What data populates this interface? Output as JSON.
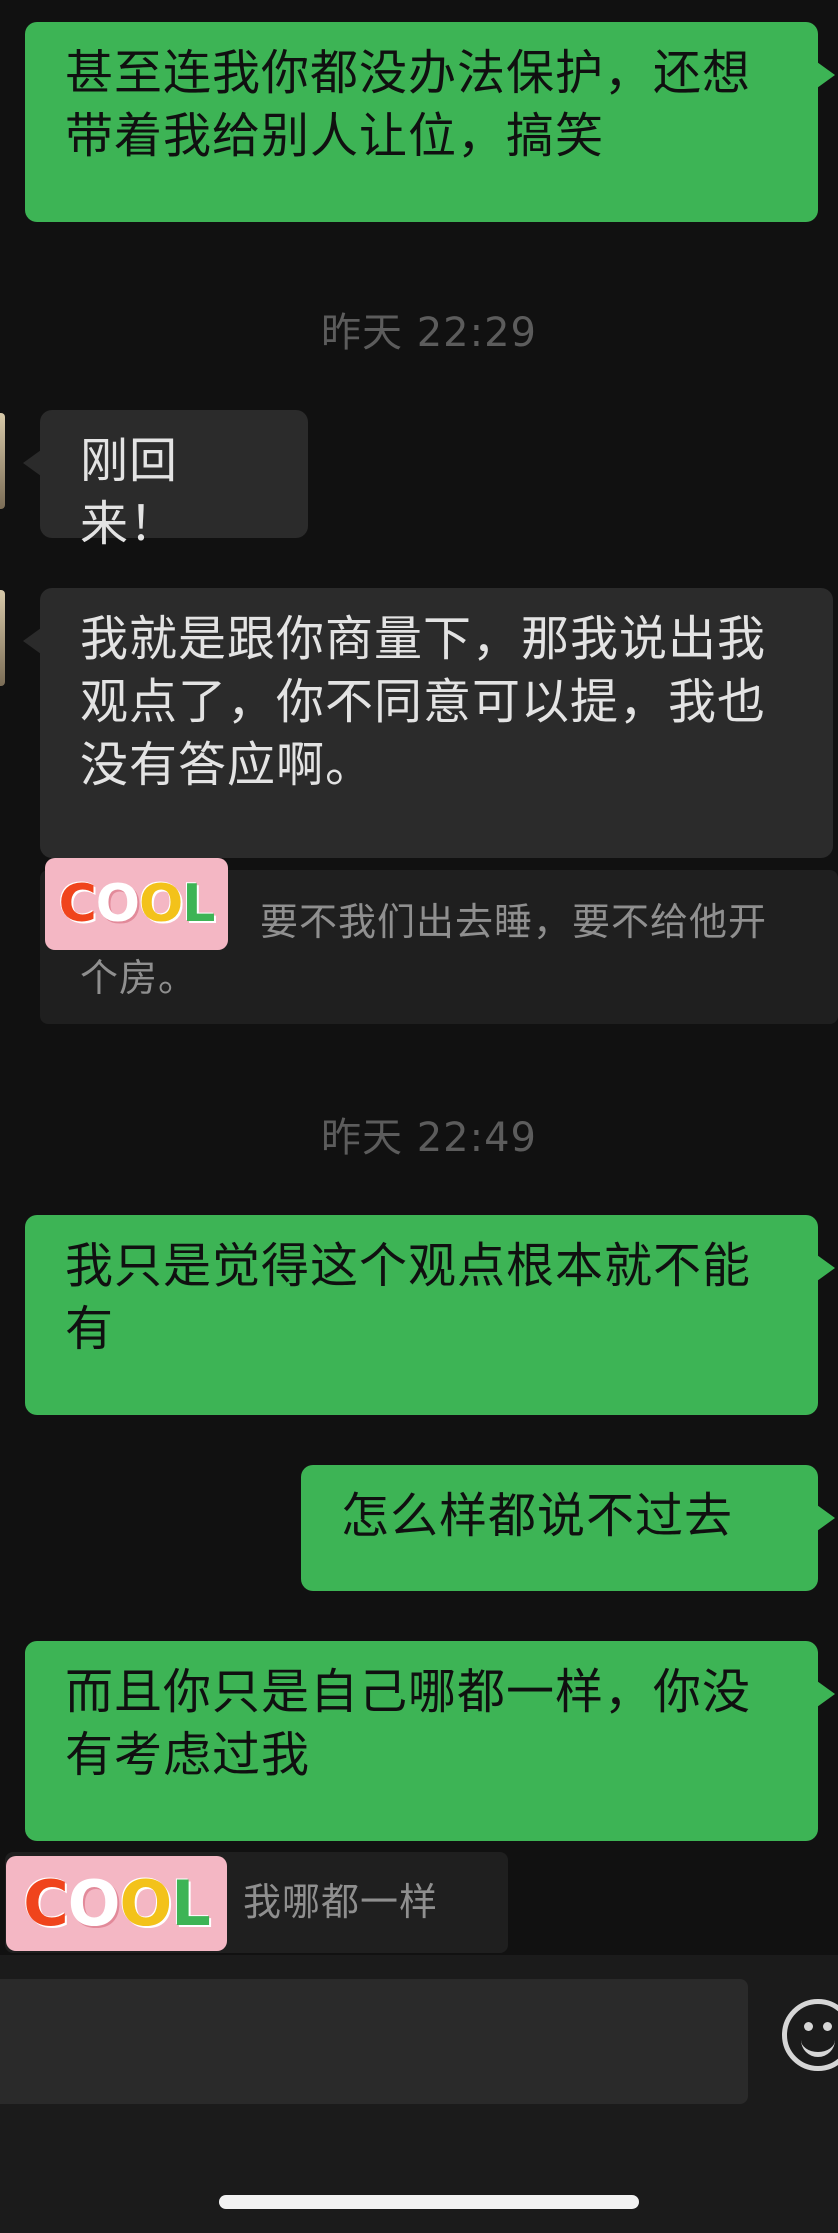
{
  "messages": {
    "m1": "甚至连我你都没办法保护，还想带着我给别人让位，搞笑",
    "t1": "昨天 22:29",
    "m2": "刚回来！",
    "m3": "我就是跟你商量下，那我说出我观点了，你不同意可以提，我也没有答应啊。",
    "q1": "要不我们出去睡，要不给他开个房。",
    "t2": "昨天 22:49",
    "m4": "我只是觉得这个观点根本就不能有",
    "m5": "怎么样都说不过去",
    "m6": "而且你只是自己哪都一样，你没有考虑过我",
    "q2": "我哪都一样"
  },
  "sticker": {
    "text": "COOL",
    "letters": [
      "C",
      "O",
      "O",
      "L"
    ],
    "colors": [
      "#f0441c",
      "#ffffff",
      "#f3c21a",
      "#3db455"
    ]
  },
  "colors": {
    "background": "#111111",
    "outgoing_bubble": "#3db455",
    "incoming_bubble": "#2b2b2b"
  },
  "icons": {
    "emoji": "smiley-face-icon"
  }
}
